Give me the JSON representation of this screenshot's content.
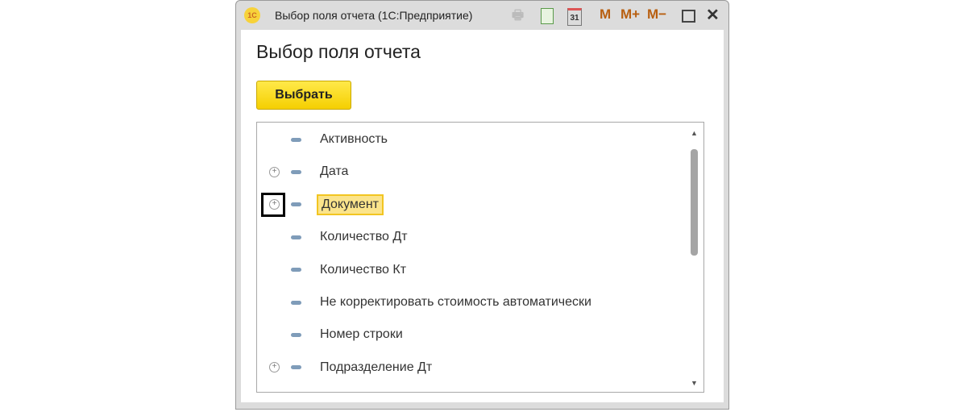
{
  "window": {
    "title": "Выбор поля отчета  (1С:Предприятие)",
    "logo": "1С",
    "toolbar": {
      "m": "M",
      "m_plus": "M+",
      "m_minus": "M−"
    }
  },
  "heading": "Выбор поля отчета",
  "select_button": "Выбрать",
  "items": [
    {
      "label": "Активность",
      "expandable": false
    },
    {
      "label": "Дата",
      "expandable": true
    },
    {
      "label": "Документ",
      "expandable": true,
      "selected": true
    },
    {
      "label": "Количество Дт",
      "expandable": false
    },
    {
      "label": "Количество Кт",
      "expandable": false
    },
    {
      "label": "Не корректировать стоимость автоматически",
      "expandable": false
    },
    {
      "label": "Номер строки",
      "expandable": false
    },
    {
      "label": "Подразделение Дт",
      "expandable": true
    }
  ]
}
